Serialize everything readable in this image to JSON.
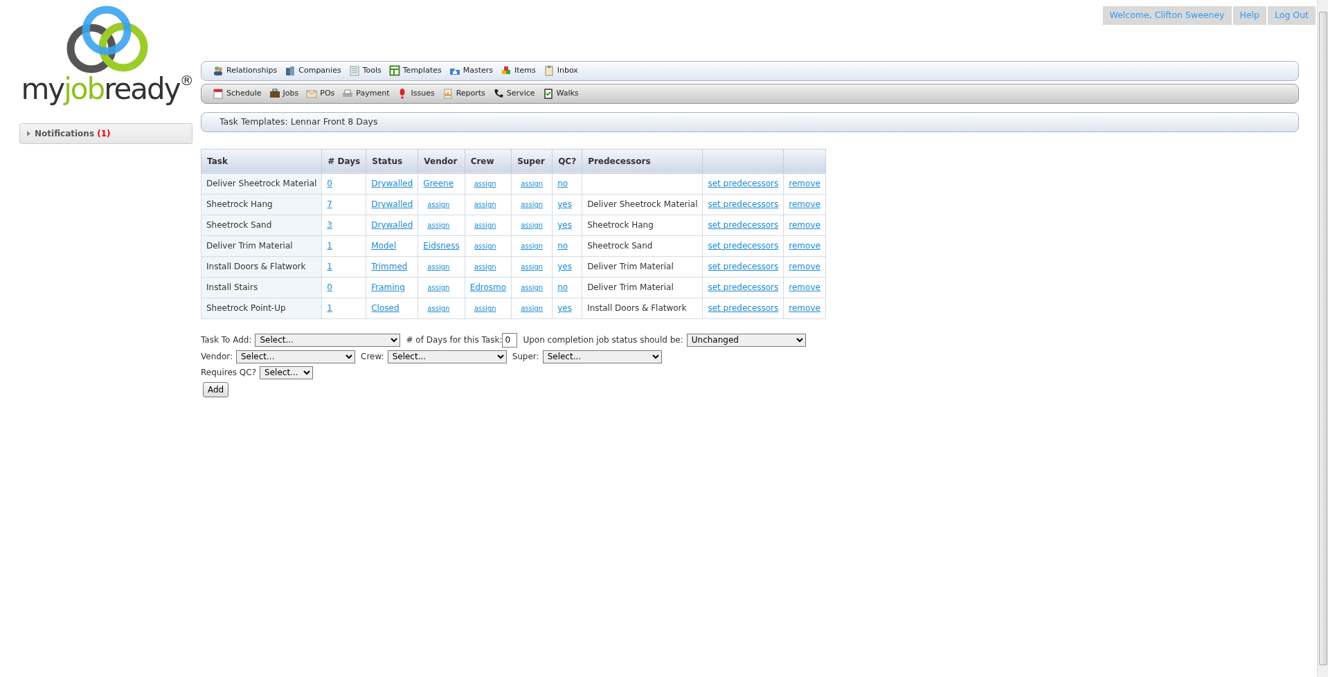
{
  "logo": {
    "before": "my",
    "highlight": "job",
    "after": "ready",
    "mark": "®"
  },
  "user_bar": [
    "Welcome, Clifton Sweeney",
    "Help",
    "Log Out"
  ],
  "nav_rows": [
    [
      {
        "label": "Relationships"
      },
      {
        "label": "Companies"
      },
      {
        "label": "Tools"
      },
      {
        "label": "Templates"
      },
      {
        "label": "Masters"
      },
      {
        "label": "Items"
      },
      {
        "label": "Inbox"
      }
    ],
    [
      {
        "label": "Schedule"
      },
      {
        "label": "Jobs"
      },
      {
        "label": "POs"
      },
      {
        "label": "Payment"
      },
      {
        "label": "Issues"
      },
      {
        "label": "Reports"
      },
      {
        "label": "Service"
      },
      {
        "label": "Walks"
      }
    ]
  ],
  "sidebar": {
    "label": "Notifications",
    "count": "(1)",
    "expanded": false
  },
  "page_title": "Task Templates: Lennar Front 8 Days",
  "table": {
    "columns": [
      {
        "header": "Task",
        "kind": "text"
      },
      {
        "header": "# Days",
        "kind": "link"
      },
      {
        "header": "Status",
        "kind": "link"
      },
      {
        "header": "Vendor",
        "kind": "assign"
      },
      {
        "header": "Crew",
        "kind": "assign"
      },
      {
        "header": "Super",
        "kind": "assign"
      },
      {
        "header": "QC?",
        "kind": "link"
      },
      {
        "header": "Predecessors",
        "kind": "text"
      },
      {
        "kind": "link"
      },
      {
        "kind": "link"
      }
    ],
    "rows": [
      {
        "cells": [
          "Deliver Sheetrock Material",
          "0",
          "Drywalled",
          {
            "text": "Greene",
            "assigned": true
          },
          {
            "text": "assign",
            "assigned": false
          },
          {
            "text": "assign",
            "assigned": false
          },
          "no",
          "",
          "set predecessors",
          "remove"
        ]
      },
      {
        "cells": [
          "Sheetrock Hang",
          "7",
          "Drywalled",
          {
            "text": "assign",
            "assigned": false
          },
          {
            "text": "assign",
            "assigned": false
          },
          {
            "text": "assign",
            "assigned": false
          },
          "yes",
          "Deliver Sheetrock Material",
          "set predecessors",
          "remove"
        ]
      },
      {
        "cells": [
          "Sheetrock Sand",
          "3",
          "Drywalled",
          {
            "text": "assign",
            "assigned": false
          },
          {
            "text": "assign",
            "assigned": false
          },
          {
            "text": "assign",
            "assigned": false
          },
          "yes",
          "Sheetrock Hang",
          "set predecessors",
          "remove"
        ]
      },
      {
        "cells": [
          "Deliver Trim Material",
          "1",
          "Model",
          {
            "text": "Eidsness",
            "assigned": true
          },
          {
            "text": "assign",
            "assigned": false
          },
          {
            "text": "assign",
            "assigned": false
          },
          "no",
          "Sheetrock Sand",
          "set predecessors",
          "remove"
        ]
      },
      {
        "cells": [
          "Install Doors & Flatwork",
          "1",
          "Trimmed",
          {
            "text": "assign",
            "assigned": false
          },
          {
            "text": "assign",
            "assigned": false
          },
          {
            "text": "assign",
            "assigned": false
          },
          "yes",
          "Deliver Trim Material",
          "set predecessors",
          "remove"
        ]
      },
      {
        "cells": [
          "Install Stairs",
          "0",
          "Framing",
          {
            "text": "assign",
            "assigned": false
          },
          {
            "text": "Edrosmo",
            "assigned": true
          },
          {
            "text": "assign",
            "assigned": false
          },
          "no",
          "Deliver Trim Material",
          "set predecessors",
          "remove"
        ]
      },
      {
        "cells": [
          "Sheetrock Point-Up",
          "1",
          "Closed",
          {
            "text": "assign",
            "assigned": false
          },
          {
            "text": "assign",
            "assigned": false
          },
          {
            "text": "assign",
            "assigned": false
          },
          "yes",
          "Install Doors & Flatwork",
          "set predecessors",
          "remove"
        ]
      }
    ]
  },
  "form": {
    "lines": [
      [
        {
          "kind": "select",
          "label": "Task To Add:",
          "value": "Select..."
        },
        {
          "kind": "input",
          "label": "# of Days for this Task:",
          "value": "0"
        },
        {
          "kind": "select",
          "label": "Upon completion job status should be:",
          "value": "Unchanged"
        }
      ],
      [
        {
          "kind": "select",
          "label": "Vendor:",
          "value": "Select..."
        },
        {
          "kind": "select",
          "label": "Crew:",
          "value": "Select..."
        },
        {
          "kind": "select",
          "label": "Super:",
          "value": "Select..."
        }
      ],
      [
        {
          "kind": "select",
          "label": "Requires QC?",
          "value": "Select..."
        }
      ]
    ],
    "submit": "Add"
  }
}
